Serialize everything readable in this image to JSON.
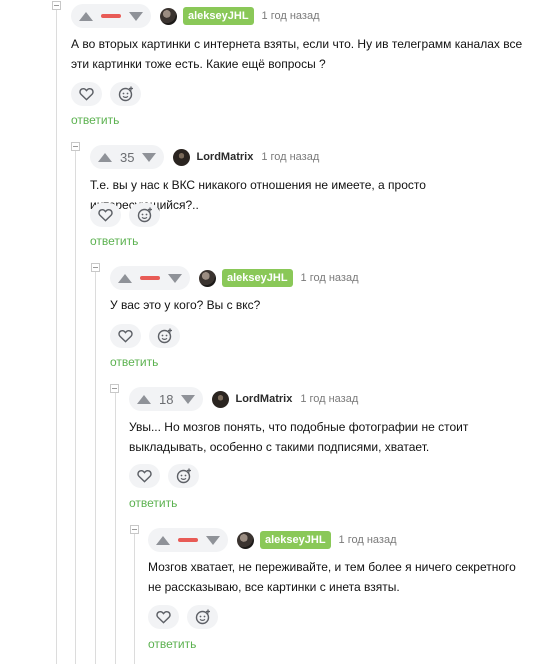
{
  "comments": [
    {
      "author": "aleksеyJHL",
      "time": "1 год назад",
      "rating": "",
      "text": "А во вторых картинки с интернета взяты, если что. Ну ив телеграмм каналах все эти картинки тоже есть. Какие ещё вопросы ?",
      "reply": "ответить"
    },
    {
      "author": "LordMatrix",
      "time": "1 год назад",
      "rating": "35",
      "text": "Т.е. вы у нас к ВКС никакого отношения не имеете, а просто интересующийся?..",
      "reply": "ответить"
    },
    {
      "author": "aleksеyJHL",
      "time": "1 год назад",
      "rating": "",
      "text": "У вас это у кого? Вы с вкс?",
      "reply": "ответить"
    },
    {
      "author": "LordMatrix",
      "time": "1 год назад",
      "rating": "18",
      "text": "Увы... Но мозгов понять, что подобные фотографии не стоит выкладывать, особенно с такими подписями, хватает.",
      "reply": "ответить"
    },
    {
      "author": "aleksеyJHL",
      "time": "1 год назад",
      "rating": "",
      "text": "Мозгов хватает, не переживайте, и тем более я ничего секретного не рассказываю, все картинки с инета взяты.",
      "reply": "ответить"
    }
  ],
  "icons": {
    "upvote": "arrow-up-icon",
    "downvote": "arrow-down-icon",
    "like": "heart-icon",
    "react": "smiley-plus-icon",
    "collapse": "collapse-minus-icon"
  },
  "colors": {
    "author_badge": "#8ac858",
    "negative_rating": "#e85b56",
    "reply_link": "#5bb14f",
    "pill_bg": "#f2f3f5"
  }
}
